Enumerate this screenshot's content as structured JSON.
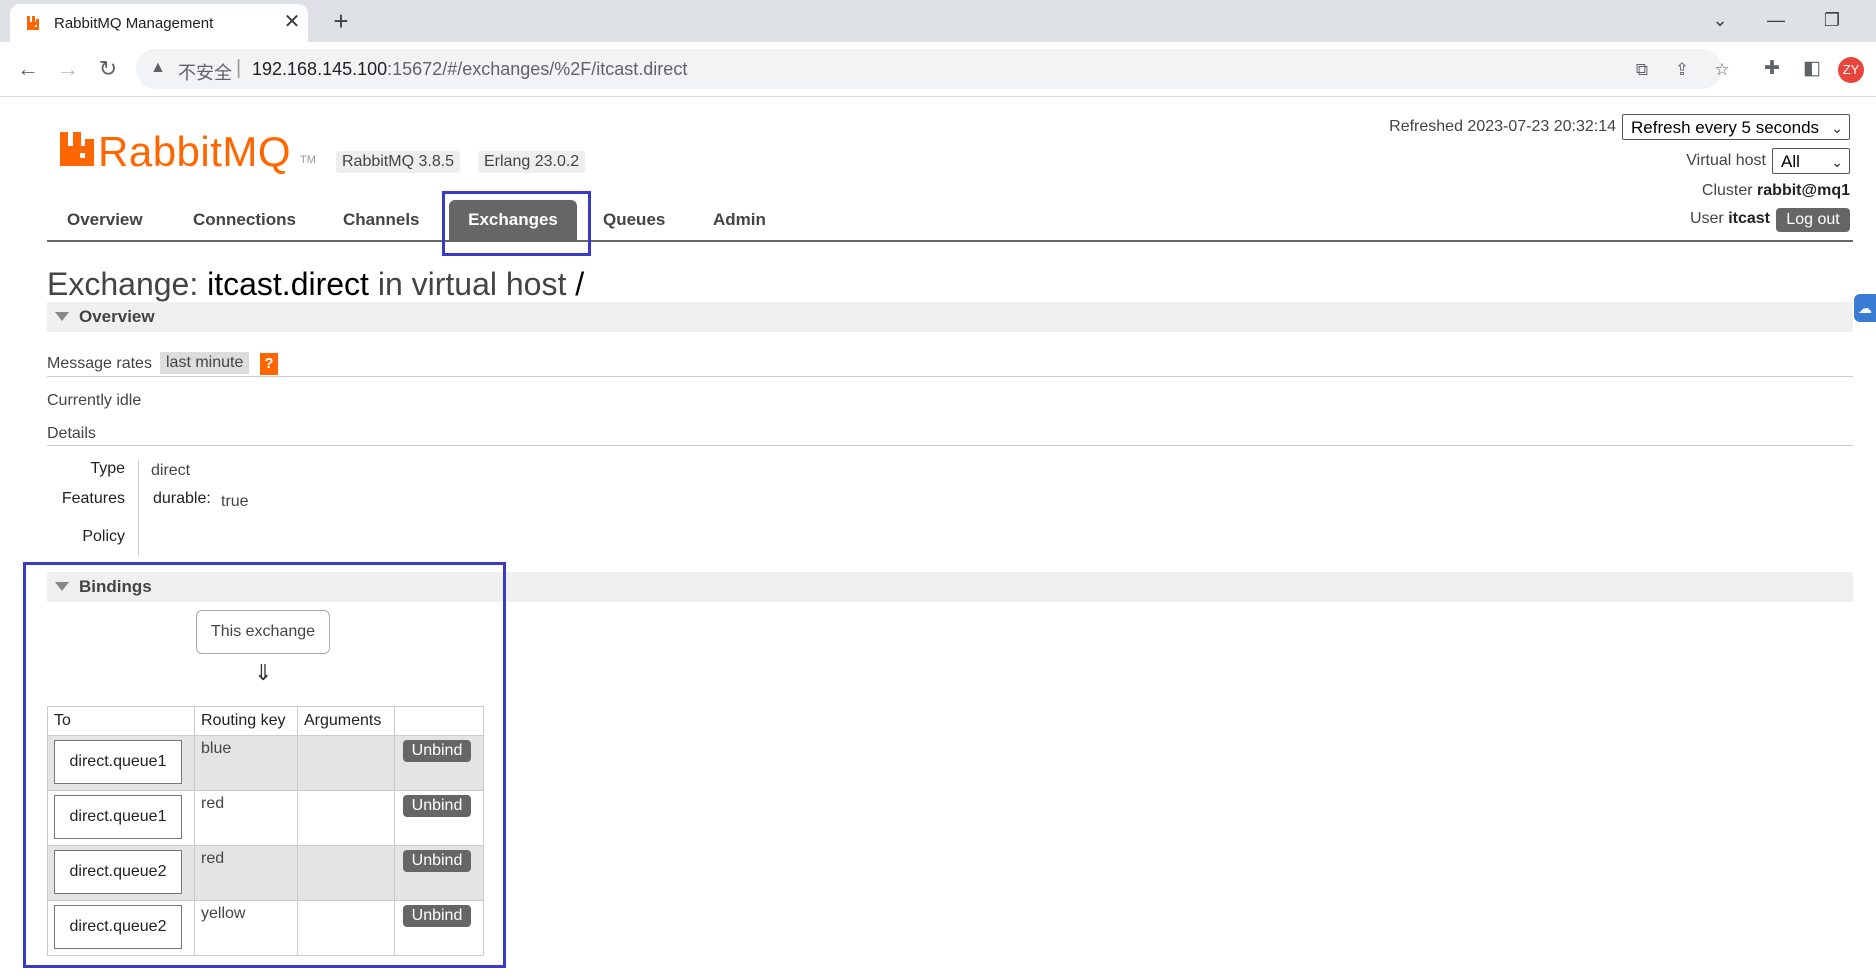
{
  "browser": {
    "tab_title": "RabbitMQ Management",
    "tab_close": "✕",
    "new_tab": "+",
    "insecure_label": "不安全",
    "url_host": "192.168.145.100",
    "url_rest": ":15672/#/exchanges/%2F/itcast.direct",
    "profile_initials": "ZY"
  },
  "header": {
    "logo_text": "RabbitMQ",
    "logo_tm": "TM",
    "rabbitmq_version": "RabbitMQ 3.8.5",
    "erlang_version": "Erlang 23.0.2",
    "refreshed_label": "Refreshed 2023-07-23 20:32:14",
    "refresh_select": "Refresh every 5 seconds",
    "vhost_label": "Virtual host",
    "vhost_select": "All",
    "cluster_label": "Cluster",
    "cluster_value": "rabbit@mq1",
    "user_label": "User",
    "user_value": "itcast",
    "logout_label": "Log out"
  },
  "nav": {
    "tabs": [
      "Overview",
      "Connections",
      "Channels",
      "Exchanges",
      "Queues",
      "Admin"
    ],
    "active": "Exchanges"
  },
  "page": {
    "title_prefix": "Exchange:",
    "exchange_name": "itcast.direct",
    "title_mid": "in virtual host",
    "vhost_name": "/"
  },
  "overview": {
    "section_title": "Overview",
    "message_rates_label": "Message rates",
    "rate_period": "last minute",
    "help": "?",
    "idle_text": "Currently idle",
    "details_label": "Details",
    "type_label": "Type",
    "type_value": "direct",
    "features_label": "Features",
    "durable_label": "durable:",
    "durable_value": "true",
    "policy_label": "Policy"
  },
  "bindings": {
    "section_title": "Bindings",
    "this_exchange": "This exchange",
    "arrow": "⇓",
    "columns": [
      "To",
      "Routing key",
      "Arguments"
    ],
    "unbind_label": "Unbind",
    "rows": [
      {
        "to": "direct.queue1",
        "routing_key": "blue",
        "arguments": ""
      },
      {
        "to": "direct.queue1",
        "routing_key": "red",
        "arguments": ""
      },
      {
        "to": "direct.queue2",
        "routing_key": "red",
        "arguments": ""
      },
      {
        "to": "direct.queue2",
        "routing_key": "yellow",
        "arguments": ""
      }
    ]
  },
  "colors": {
    "brand": "#ff6600",
    "highlight_box": "#3a3ac8",
    "tab_active": "#666666"
  }
}
